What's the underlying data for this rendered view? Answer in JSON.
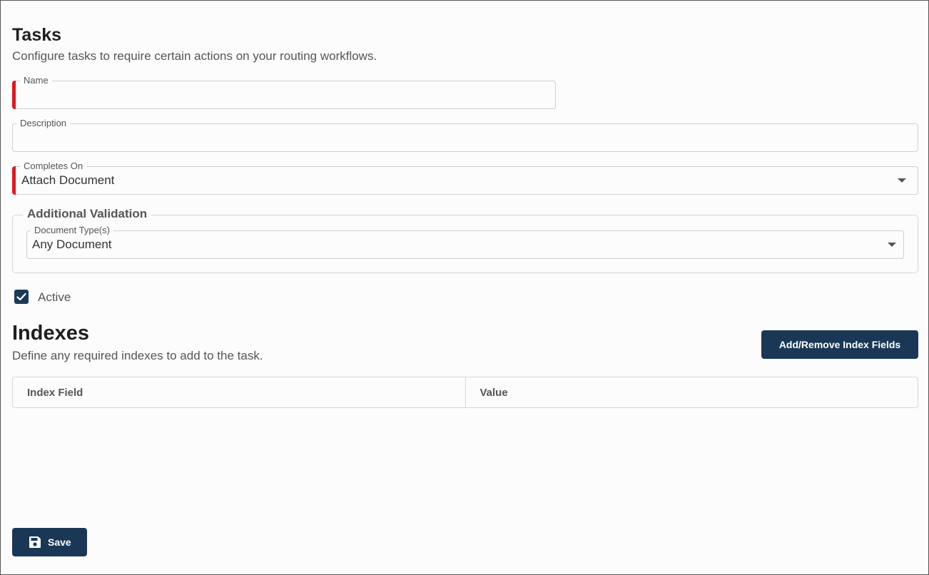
{
  "tasks": {
    "title": "Tasks",
    "subtitle": "Configure tasks to require certain actions on your routing workflows."
  },
  "form": {
    "name": {
      "label": "Name",
      "value": "",
      "required": true
    },
    "description": {
      "label": "Description",
      "value": ""
    },
    "completes_on": {
      "label": "Completes On",
      "value": "Attach Document",
      "required": true
    },
    "additional_validation": {
      "legend": "Additional Validation",
      "document_types": {
        "label": "Document Type(s)",
        "value": "Any Document"
      }
    },
    "active": {
      "label": "Active",
      "checked": true
    }
  },
  "indexes": {
    "title": "Indexes",
    "subtitle": "Define any required indexes to add to the task.",
    "add_remove_label": "Add/Remove Index Fields",
    "columns": [
      "Index Field",
      "Value"
    ]
  },
  "footer": {
    "save_label": "Save"
  },
  "colors": {
    "primary": "#1a3856",
    "required": "#e0171f"
  }
}
